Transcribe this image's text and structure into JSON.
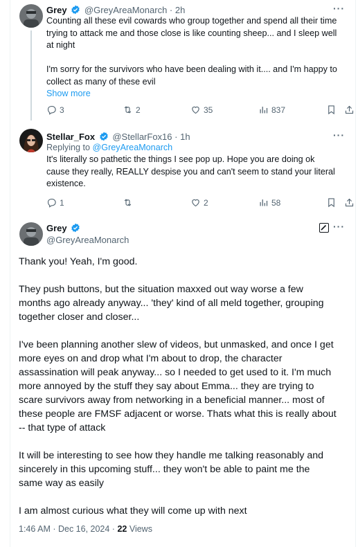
{
  "post1": {
    "name": "Grey",
    "handle": "@GreyAreaMonarch",
    "time": "2h",
    "dot": "·",
    "more": "···",
    "text_line1": "Counting all these evil cowards who group together and spend all their time",
    "text_line2": "trying to attack me and those close is like counting sheep... and I sleep well",
    "text_line3": "at night",
    "text_line4": "I'm sorry for the survivors who have been dealing with it.... and I'm happy to",
    "text_line5": "collect as many of these evil",
    "show_more": "Show more",
    "replies": "3",
    "reposts": "2",
    "likes": "35",
    "views": "837"
  },
  "post2": {
    "name": "Stellar_Fox",
    "handle": "@StellarFox16",
    "time": "1h",
    "dot": "·",
    "more": "···",
    "replying_prefix": "Replying to ",
    "replying_to": "@GreyAreaMonarch",
    "text_line1": "It's literally so pathetic the things I see pop up. Hope you are doing ok",
    "text_line2": "cause they really, REALLY despise you and can't seem to stand your literal",
    "text_line3": "existence.",
    "replies": "1",
    "reposts": "",
    "likes": "2",
    "views": "58"
  },
  "post3": {
    "name": "Grey",
    "handle": "@GreyAreaMonarch",
    "more": "···",
    "para1": "Thank you! Yeah, I'm good.",
    "para2_line1": "They push buttons, but the situation maxxed out way worse a few",
    "para2_line2": "months ago already anyway... 'they' kind of all meld together, grouping",
    "para2_line3": "together closer and closer...",
    "para3_line1": "I've been planning another slew of videos, but unmasked, and once I get",
    "para3_line2": "more eyes on and drop what I'm about to drop, the character",
    "para3_line3": "assassination will peak anyway... so I needed to get used to it. I'm much",
    "para3_line4": "more annoyed by the stuff they say about Emma... they are trying to",
    "para3_line5": "scare survivors away from networking in a beneficial manner... most of",
    "para3_line6": "these people are FMSF adjacent or worse. Thats what this is really about",
    "para3_line7": "-- that type of attack",
    "para4_line1": "It will be interesting to see how they handle me talking reasonably and",
    "para4_line2": "sincerely in this upcoming stuff... they won't be able to paint me the",
    "para4_line3": "same way as easily",
    "para5": "I am almost curious what they will come up with next",
    "timestamp": "1:46 AM · Dec 16, 2024 · ",
    "view_count": "22",
    "views_label": " Views"
  },
  "icons": {
    "reply": "reply-icon",
    "repost": "repost-icon",
    "like": "heart-icon",
    "views": "views-icon",
    "bookmark": "bookmark-icon",
    "share": "share-icon",
    "verified": "verified-badge-icon",
    "edit": "edit-icon"
  },
  "colors": {
    "accent": "#1d9bf0",
    "muted": "#536471",
    "text": "#0f1419"
  }
}
